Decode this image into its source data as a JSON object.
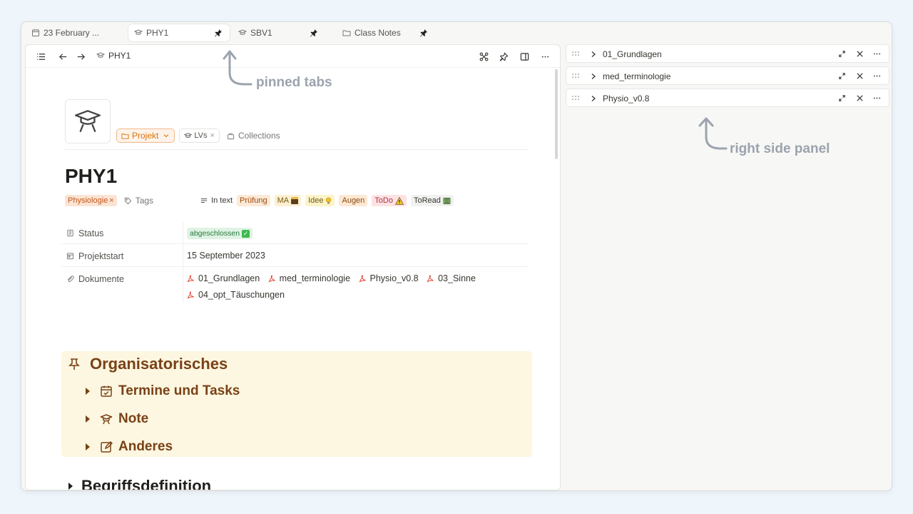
{
  "tabs": [
    {
      "label": "23 February ...",
      "icon": "calendar-icon",
      "active": false,
      "pinned": false
    },
    {
      "label": "PHY1",
      "icon": "mortarboard-icon",
      "active": true,
      "pinned": true
    },
    {
      "label": "SBV1",
      "icon": "mortarboard-icon",
      "active": false,
      "pinned": true
    },
    {
      "label": "Class Notes",
      "icon": "folder-icon",
      "active": false,
      "pinned": true
    }
  ],
  "editor": {
    "breadcrumb": "PHY1",
    "chips": {
      "projekt": "Projekt",
      "lvs": "LVs",
      "collections": "Collections"
    },
    "title": "PHY1",
    "tags": {
      "physiologie": "Physiologie",
      "tags_label": "Tags",
      "in_text": "In text",
      "items": [
        "Prüfung",
        "MA",
        "Idee",
        "Augen",
        "ToDo",
        "ToRead"
      ]
    },
    "properties": {
      "status_label": "Status",
      "status_value": "abgeschlossen",
      "projektstart_label": "Projektstart",
      "projektstart_value": "15 September 2023",
      "dokumente_label": "Dokumente",
      "dokumente": [
        "01_Grundlagen",
        "med_terminologie",
        "Physio_v0.8",
        "03_Sinne",
        "04_opt_Täuschungen"
      ]
    },
    "callout": {
      "heading": "Organisatorisches",
      "items": [
        "Termine und Tasks",
        "Note",
        "Anderes"
      ]
    },
    "section": "Begriffsdefinition"
  },
  "right_panel": {
    "items": [
      "01_Grundlagen",
      "med_terminologie",
      "Physio_v0.8"
    ]
  },
  "annotations": {
    "pinned_tabs": "pinned tabs",
    "right_side_panel": "right side panel"
  },
  "colors": {
    "accent_orange": "#d9730d",
    "callout_bg": "#fdf7e1",
    "callout_text": "#7a4117",
    "annotation": "#9ba3ae"
  }
}
